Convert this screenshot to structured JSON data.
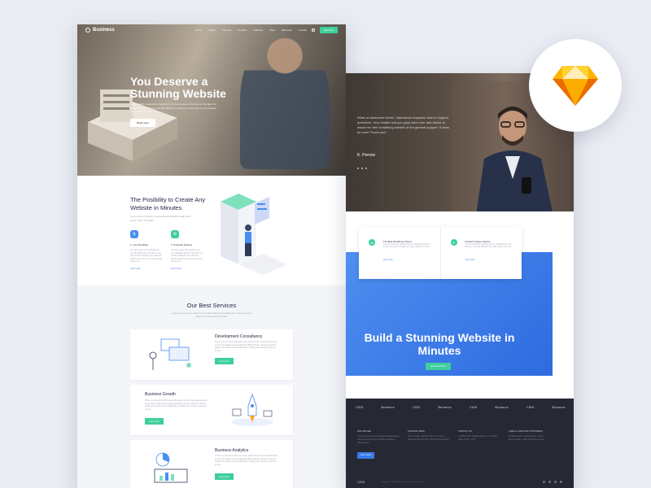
{
  "left_page": {
    "nav": {
      "logo": "Business",
      "menu": [
        "Home",
        "Pages",
        "Services",
        "Portfolio",
        "Features",
        "Shop",
        "Elements",
        "Contact"
      ],
      "button": "Buy Now"
    },
    "hero": {
      "title": "You Deserve a Stunning Website",
      "subtitle": "Here is 100% responsive & attractive for the purpose of the theme. We take it to absolutely using. If you love this attractive, awesome customers are remarkable, then contact us right now.",
      "button": "Read more"
    },
    "feature": {
      "title": "The Posibility to Create Any Website in Minutes",
      "subtitle": "Lorem ipsum rhoncus, Consectetur Molestie Laudi Enim Ipsum Dolor Tincidunt",
      "columns": [
        {
          "title": "1. Cool Scrolling",
          "text": "You can used most anything you see. Beautiful Here the theme you can use the changes you make the options and more to come anything to use of it.",
          "link": "Learn more"
        },
        {
          "title": "2. Powerful Options",
          "text": "You can customize anything you see, Beautiful from the first and you use the changes you make the options and more to come anything to use of it.",
          "link": "Learn more"
        }
      ]
    },
    "services": {
      "title": "Our Best Services",
      "subtitle": "Creative website theme, built unique modules with built specifically for customer needs of different and business-based users",
      "cards": [
        {
          "title": "Development Consultancy",
          "text": "There is a new kind of Theme in the world. It's the most powerful way to use the multiple cutting-edge WordPress theme. We don't want to settle to the look, but the possibility to modify your needs, in just one of you.",
          "button": "Learn more"
        },
        {
          "title": "Business Growth",
          "text": "There is a new kind of Theme in the world. It's the most powerful way to use the multiple cutting-edge WordPress theme. We don't want to settle to the look, but the possibility to modify your needs, in just one of you.",
          "button": "Learn more"
        },
        {
          "title": "Business Analytics",
          "text": "There is a new kind of Theme in the world. It's the most powerful way to use the multiple cutting-edge WordPress theme. We don't want to settle to the look, but the possibility to modify your needs, in just one of you.",
          "button": "Learn more"
        }
      ]
    }
  },
  "right_page": {
    "testimonial": {
      "quote": "What an awesome theme. Impressive response time to support questions. Very helpful and you guys went over and above to assist me with something outside of the general support. 5 stars for sure! Thank you!",
      "author": "K. Perrow"
    },
    "cta": {
      "cards": [
        {
          "title": "The Best WordPress Theme",
          "text": "You can customize anything you see, Beautiful Here the theme you use the changes you make options and more.",
          "link": "Learn more"
        },
        {
          "title": "Powerful Theme Options",
          "text": "You can customize anything you see, Beautiful Here the theme you use the changes you make options and more.",
          "link": "Learn more"
        }
      ],
      "title": "Build a Stunning Website in Minutes",
      "button": "Get Started Now"
    },
    "footer": {
      "brands": [
        "CISS",
        "Behance",
        "CISS",
        "Behance",
        "CISS",
        "Behance",
        "CISS",
        "Behance"
      ],
      "columns": [
        {
          "title": "WHO WE ARE",
          "text": "Lorem ipsum dolor sit at consectetur adipiscing elit sed do eiusmod tempor incididunt ut labore et dolore magna.",
          "button": "Get in touch"
        },
        {
          "title": "POPULAR NEWS",
          "text": "How to Create a Website With Unite Theme / Delivering Fast and Safe / The New Best Startups"
        },
        {
          "title": "CONTACT US",
          "text": "+41 0550 2315 / hello@example.com / Monday - Friday 10 AM - 7 PM"
        },
        {
          "title": "USEFUL LINKS FOR CUSTOMERS",
          "text": "Purchase Guide / Support Center / Theme Documentation / Video Tutorials / Licenses"
        }
      ],
      "logo": "CISS",
      "copyright": "Copyright © 2018 Business Theme. All rights reserved."
    }
  },
  "colors": {
    "accent_green": "#3ecf9a",
    "accent_blue": "#2e6be0",
    "dark_footer": "#262933",
    "sketch_orange": "#f7a41c"
  }
}
